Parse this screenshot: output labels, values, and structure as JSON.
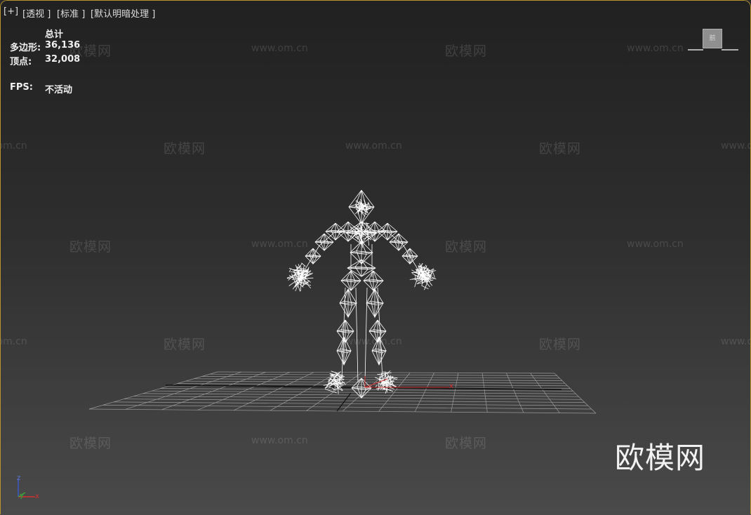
{
  "viewport": {
    "labels": [
      "[+]",
      "[透视 ]",
      "[标准 ]",
      "[默认明暗处理 ]"
    ],
    "stats": {
      "header": "总计",
      "poly_label": "多边形:",
      "poly_value": "36,136",
      "vert_label": "顶点:",
      "vert_value": "32,008",
      "fps_label": "FPS:",
      "fps_value": "不活动"
    },
    "viewcube_label": "前",
    "watermark_cn": "欧模网",
    "watermark_url": "www.om.cn",
    "logo_text": "欧模网",
    "axis_tripod": {
      "z": "z",
      "y": "y",
      "x": "x"
    },
    "gizmo_x_label": "x"
  },
  "colors": {
    "border": "#b9952e",
    "wireframe": "#ffffff",
    "x_axis": "#d23030",
    "y_axis": "#3aa83a",
    "z_axis": "#3a5ad2"
  }
}
